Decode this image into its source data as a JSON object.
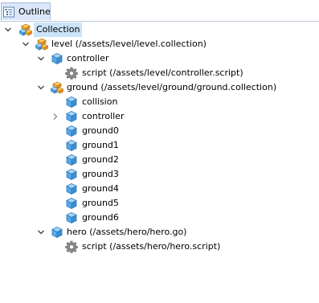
{
  "tab": {
    "label": "Outline"
  },
  "tree": {
    "collection": "Collection",
    "level": "level (/assets/level/level.collection)",
    "level_controller": "controller",
    "level_controller_script": "script (/assets/level/controller.script)",
    "ground": "ground (/assets/level/ground/ground.collection)",
    "ground_collision": "collision",
    "ground_controller": "controller",
    "ground0": "ground0",
    "ground1": "ground1",
    "ground2": "ground2",
    "ground3": "ground3",
    "ground4": "ground4",
    "ground5": "ground5",
    "ground6": "ground6",
    "hero": "hero (/assets/hero/hero.go)",
    "hero_script": "script (/assets/hero/hero.script)"
  },
  "colors": {
    "selection": "#cce4f7",
    "tab_background": "#dbe7f8",
    "cube_blue": "#5aa9e6",
    "collection_orange": "#f39b2c"
  }
}
